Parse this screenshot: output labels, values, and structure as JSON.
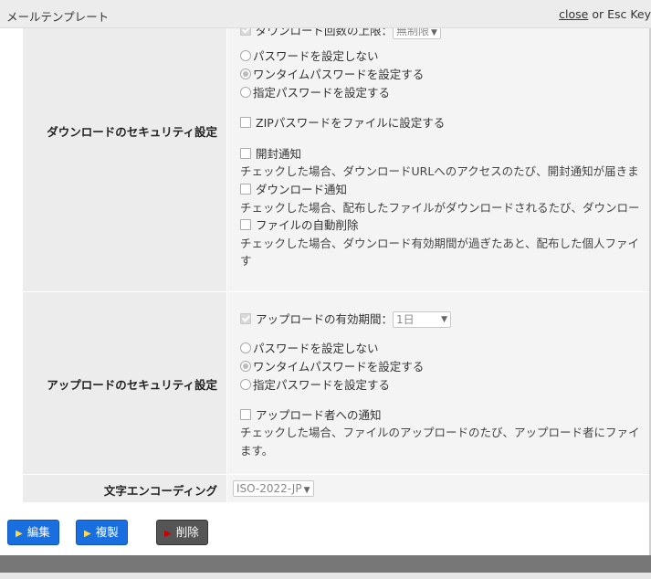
{
  "header": {
    "title": "メールテンプレート",
    "close_link": "close",
    "close_suffix": " or Esc Key"
  },
  "download_security": {
    "label": "ダウンロードのセキュリティ設定",
    "download_limit_label": "ダウンロード回数の上限：",
    "download_limit_value": "無制限",
    "pw_none": "パスワードを設定しない",
    "pw_onetime": "ワンタイムパスワードを設定する",
    "pw_specified": "指定パスワードを設定する",
    "pw_selected": "ワンタイムパスワードを設定する",
    "zip_pw": "ZIPパスワードをファイルに設定する",
    "open_notice": "開封通知",
    "open_notice_desc": "チェックした場合、ダウンロードURLへのアクセスのたび、開封通知が届きま",
    "download_notice": "ダウンロード通知",
    "download_notice_desc": "チェックした場合、配布したファイルがダウンロードされるたび、ダウンロー",
    "auto_delete": "ファイルの自動削除",
    "auto_delete_desc_1": "チェックした場合、ダウンロード有効期間が過ぎたあと、配布した個人ファイ",
    "auto_delete_desc_2": "す"
  },
  "upload_security": {
    "label": "アップロードのセキュリティ設定",
    "expiry_label": "アップロードの有効期間：",
    "expiry_value": "1日",
    "pw_none": "パスワードを設定しない",
    "pw_onetime": "ワンタイムパスワードを設定する",
    "pw_specified": "指定パスワードを設定する",
    "pw_selected": "ワンタイムパスワードを設定する",
    "uploader_notice": "アップロード者への通知",
    "uploader_notice_desc_1": "チェックした場合、ファイルのアップロードのたび、アップロード者にファイ",
    "uploader_notice_desc_2": "ます。"
  },
  "encoding": {
    "label": "文字エンコーディング",
    "value": "ISO-2022-JP"
  },
  "buttons": {
    "edit": "編集",
    "copy": "複製",
    "delete": "削除"
  }
}
